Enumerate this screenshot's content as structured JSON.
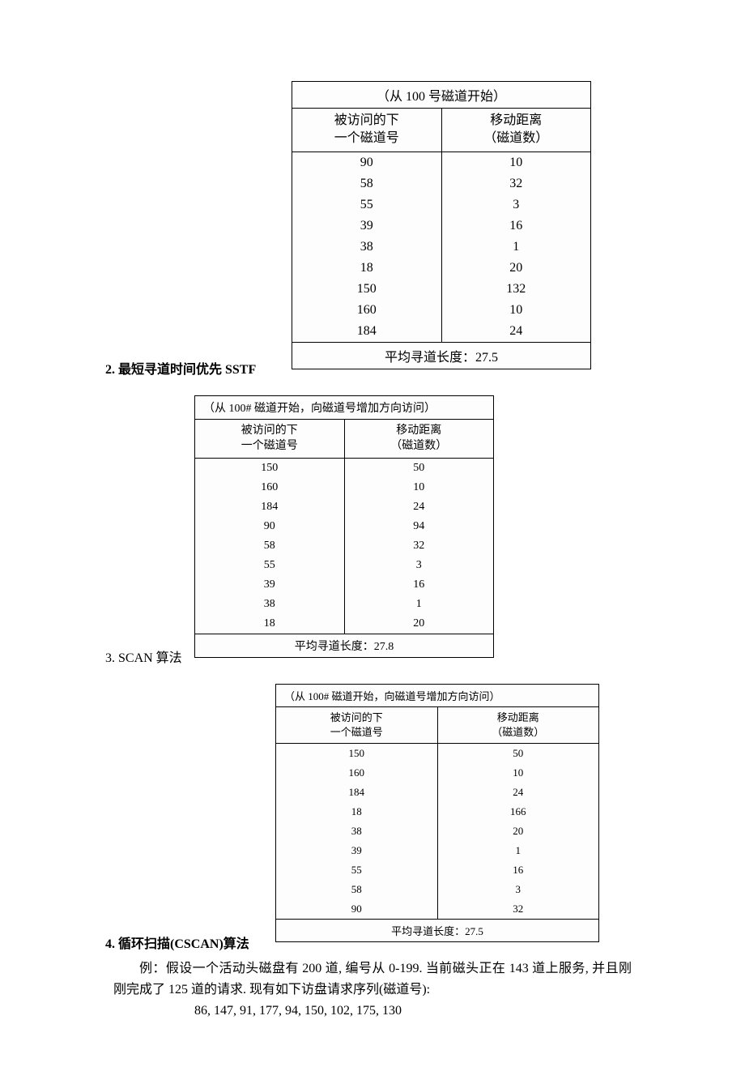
{
  "table1": {
    "title": "（从 100 号磁道开始）",
    "col1": "被访问的下\n一个磁道号",
    "col2": "移动距离\n（磁道数）",
    "rows": [
      [
        "90",
        "10"
      ],
      [
        "58",
        "32"
      ],
      [
        "55",
        "3"
      ],
      [
        "39",
        "16"
      ],
      [
        "38",
        "1"
      ],
      [
        "18",
        "20"
      ],
      [
        "150",
        "132"
      ],
      [
        "160",
        "10"
      ],
      [
        "184",
        "24"
      ]
    ],
    "footer": "平均寻道长度：27.5"
  },
  "section2": "2. 最短寻道时间优先 SSTF",
  "table2": {
    "title": "（从 100# 磁道开始，向磁道号增加方向访问）",
    "col1": "被访问的下\n一个磁道号",
    "col2": "移动距离\n（磁道数）",
    "rows": [
      [
        "150",
        "50"
      ],
      [
        "160",
        "10"
      ],
      [
        "184",
        "24"
      ],
      [
        "90",
        "94"
      ],
      [
        "58",
        "32"
      ],
      [
        "55",
        "3"
      ],
      [
        "39",
        "16"
      ],
      [
        "38",
        "1"
      ],
      [
        "18",
        "20"
      ]
    ],
    "footer": "平均寻道长度：27.8"
  },
  "section3": "3. SCAN 算法",
  "table3": {
    "title": "（从 100# 磁道开始，向磁道号增加方向访问）",
    "col1": "被访问的下\n一个磁道号",
    "col2": "移动距离\n（磁道数）",
    "rows": [
      [
        "150",
        "50"
      ],
      [
        "160",
        "10"
      ],
      [
        "184",
        "24"
      ],
      [
        "18",
        "166"
      ],
      [
        "38",
        "20"
      ],
      [
        "39",
        "1"
      ],
      [
        "55",
        "16"
      ],
      [
        "58",
        "3"
      ],
      [
        "90",
        "32"
      ]
    ],
    "footer": "平均寻道长度：27.5"
  },
  "section4": "4. 循环扫描(CSCAN)算法",
  "example": "例：假设一个活动头磁盘有 200 道, 编号从 0-199. 当前磁头正在 143 道上服务,  并且刚刚完成了 125 道的请求. 现有如下访盘请求序列(磁道号):",
  "sequence": "86, 147, 91, 177, 94, 150, 102, 175, 130"
}
